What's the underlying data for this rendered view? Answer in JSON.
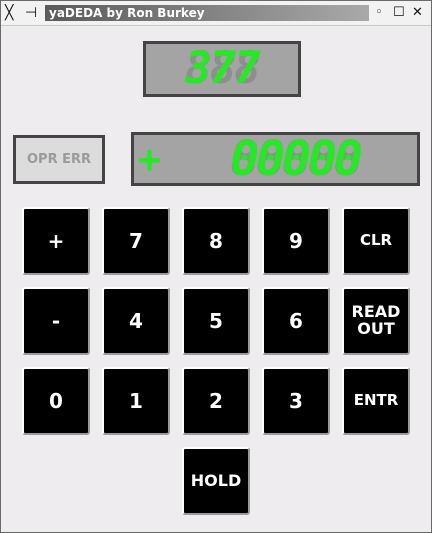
{
  "titlebar": {
    "title": "yaDEDA by Ron Burkey",
    "left_icons": [
      "x-logo-icon",
      "pin-icon"
    ],
    "right_buttons": [
      "minimize-icon",
      "maximize-icon",
      "close-icon"
    ],
    "icon_glyphs": {
      "x": "╳",
      "pin": "⊣",
      "minimize": "◦",
      "maximize": "☐",
      "close": "✕"
    }
  },
  "address_display": {
    "value": "377",
    "ghost": "888"
  },
  "data_display": {
    "sign": "+",
    "value": "00000",
    "ghost": "88888"
  },
  "opr_err": {
    "label": "OPR ERR"
  },
  "keys": {
    "plus": "+",
    "seven": "7",
    "eight": "8",
    "nine": "9",
    "clr": "CLR",
    "minus": "-",
    "four": "4",
    "five": "5",
    "six": "6",
    "readout_l1": "READ",
    "readout_l2": "OUT",
    "zero": "0",
    "one": "1",
    "two": "2",
    "three": "3",
    "entr": "ENTR",
    "hold": "HOLD"
  },
  "colors": {
    "segment_on": "#27e827",
    "segment_off": "#8e8e8e",
    "display_bg": "#a4a4a4",
    "key_bg": "#000000",
    "window_bg": "#eeecee"
  }
}
